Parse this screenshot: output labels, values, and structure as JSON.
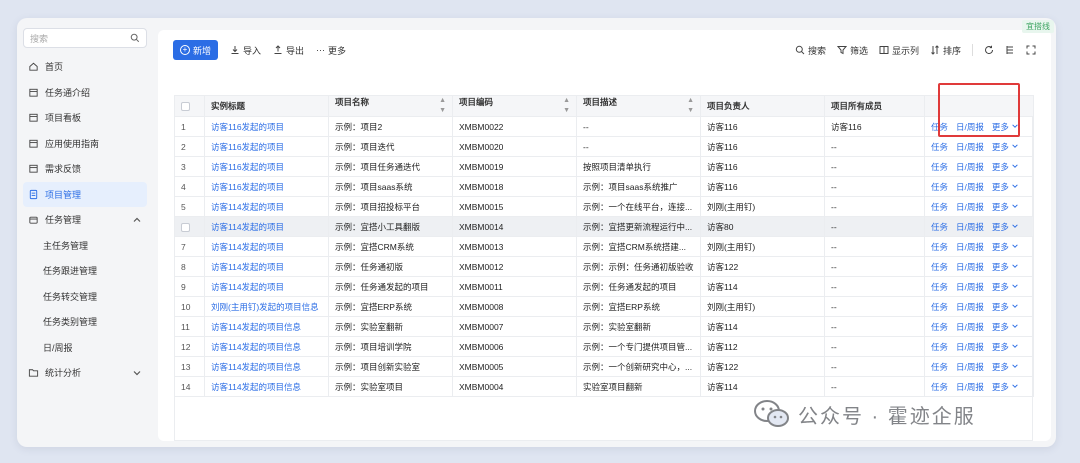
{
  "env_tag": "宜搭线",
  "sidebar": {
    "search_placeholder": "搜索",
    "items": [
      {
        "label": "首页",
        "icon": "home-icon"
      },
      {
        "label": "任务通介绍",
        "icon": "calendar-icon"
      },
      {
        "label": "项目看板",
        "icon": "calendar-icon"
      },
      {
        "label": "应用使用指南",
        "icon": "calendar-icon"
      },
      {
        "label": "需求反馈",
        "icon": "calendar-icon"
      },
      {
        "label": "项目管理",
        "icon": "document-icon",
        "active": true
      },
      {
        "label": "任务管理",
        "icon": "box-icon",
        "expanded": true
      },
      {
        "label": "主任务管理",
        "sub": true
      },
      {
        "label": "任务跟进管理",
        "sub": true
      },
      {
        "label": "任务转交管理",
        "sub": true
      },
      {
        "label": "任务类别管理",
        "sub": true
      },
      {
        "label": "日/周报",
        "sub": true
      },
      {
        "label": "统计分析",
        "icon": "folder-icon",
        "collapsed": true
      }
    ]
  },
  "toolbar": {
    "new_label": "新增",
    "import_label": "导入",
    "export_label": "导出",
    "more_label": "更多",
    "search_label": "搜索",
    "filter_label": "筛选",
    "columns_label": "显示列",
    "sort_label": "排序"
  },
  "table": {
    "headers": [
      "实例标题",
      "项目名称",
      "项目编码",
      "项目描述",
      "项目负责人",
      "项目所有成员"
    ],
    "ops": {
      "task": "任务",
      "report": "日/周报",
      "more": "更多"
    },
    "rows": [
      {
        "no": "1",
        "title": "访客116发起的项目",
        "name": "示例：项目2",
        "code": "XMBM0022",
        "desc": "--",
        "owner": "访客116",
        "members": "访客116"
      },
      {
        "no": "2",
        "title": "访客116发起的项目",
        "name": "示例：项目迭代",
        "code": "XMBM0020",
        "desc": "--",
        "owner": "访客116",
        "members": "--"
      },
      {
        "no": "3",
        "title": "访客116发起的项目",
        "name": "示例：项目任务通迭代",
        "code": "XMBM0019",
        "desc": "按照项目清单执行",
        "owner": "访客116",
        "members": "--"
      },
      {
        "no": "4",
        "title": "访客116发起的项目",
        "name": "示例：项目saas系统",
        "code": "XMBM0018",
        "desc": "示例：项目saas系统推广",
        "owner": "访客116",
        "members": "--"
      },
      {
        "no": "5",
        "title": "访客114发起的项目",
        "name": "示例：项目招投标平台",
        "code": "XMBM0015",
        "desc": "示例：一个在线平台，连接...",
        "owner": "刘刚(主用钉)",
        "members": "--"
      },
      {
        "no": "6",
        "title": "访客114发起的项目",
        "name": "示例：宜搭小工具翻版",
        "code": "XMBM0014",
        "desc": "示例：宜搭更新流程运行中...",
        "owner": "访客80",
        "members": "--",
        "hl": true
      },
      {
        "no": "7",
        "title": "访客114发起的项目",
        "name": "示例：宜搭CRM系统",
        "code": "XMBM0013",
        "desc": "示例：宜搭CRM系统搭建...",
        "owner": "刘刚(主用钉)",
        "members": "--"
      },
      {
        "no": "8",
        "title": "访客114发起的项目",
        "name": "示例：任务通初版",
        "code": "XMBM0012",
        "desc": "示例：示例：任务通初版验收",
        "owner": "访客122",
        "members": "--"
      },
      {
        "no": "9",
        "title": "访客114发起的项目",
        "name": "示例：任务通发起的项目",
        "code": "XMBM0011",
        "desc": "示例：任务通发起的项目",
        "owner": "访客114",
        "members": "--"
      },
      {
        "no": "10",
        "title": "刘刚(主用钉)发起的项目信息",
        "name": "示例：宜搭ERP系统",
        "code": "XMBM0008",
        "desc": "示例：宜搭ERP系统",
        "owner": "刘刚(主用钉)",
        "members": "--"
      },
      {
        "no": "11",
        "title": "访客114发起的项目信息",
        "name": "示例：实验室翻新",
        "code": "XMBM0007",
        "desc": "示例：实验室翻新",
        "owner": "访客114",
        "members": "--"
      },
      {
        "no": "12",
        "title": "访客114发起的项目信息",
        "name": "示例：项目培训学院",
        "code": "XMBM0006",
        "desc": "示例：一个专门提供项目管...",
        "owner": "访客112",
        "members": "--"
      },
      {
        "no": "13",
        "title": "访客114发起的项目信息",
        "name": "示例：项目创新实验室",
        "code": "XMBM0005",
        "desc": "示例：一个创新研究中心，...",
        "owner": "访客122",
        "members": "--"
      },
      {
        "no": "14",
        "title": "访客114发起的项目信息",
        "name": "示例：实验室项目",
        "code": "XMBM0004",
        "desc": "实验室项目翻新",
        "owner": "访客114",
        "members": "--"
      }
    ]
  },
  "watermark": "公众号 · 霍迹企服",
  "colors": {
    "primary": "#2b6de5",
    "highlight_box": "#e03a3a",
    "active_bg": "#e6effd"
  }
}
